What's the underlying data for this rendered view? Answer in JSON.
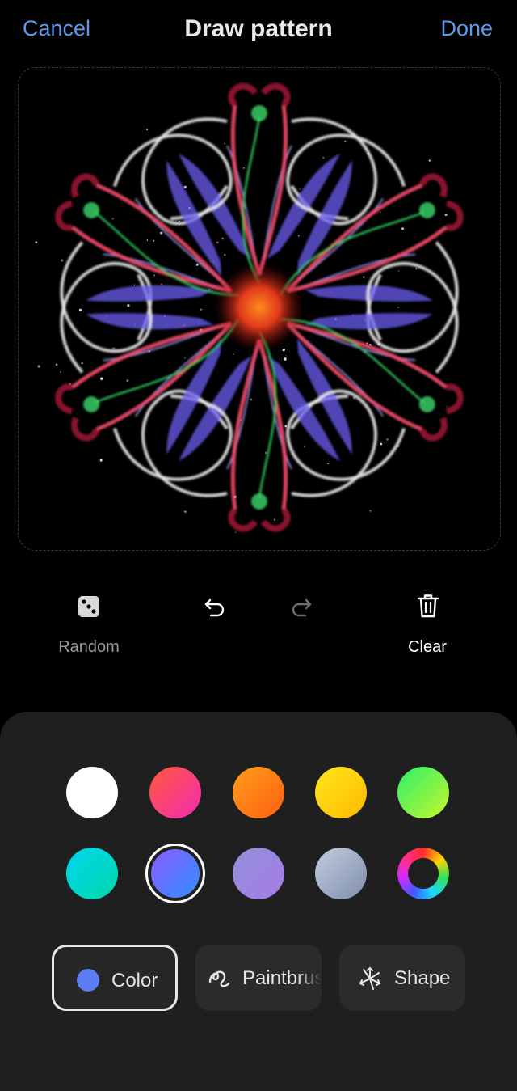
{
  "header": {
    "cancel_label": "Cancel",
    "title": "Draw pattern",
    "done_label": "Done"
  },
  "canvas": {
    "background": "#000000",
    "petal_count": 6
  },
  "tools": {
    "random_label": "Random",
    "undo_enabled": true,
    "redo_enabled": false,
    "clear_label": "Clear"
  },
  "palette": {
    "rows": [
      [
        {
          "name": "white",
          "color": "#ffffff"
        },
        {
          "name": "red-pink",
          "gradient": [
            "#ff5a3c",
            "#f22bb5"
          ]
        },
        {
          "name": "orange",
          "gradient": [
            "#ff9f1a",
            "#ff5e14"
          ]
        },
        {
          "name": "yellow",
          "gradient": [
            "#ffe81f",
            "#ffb800"
          ]
        },
        {
          "name": "green",
          "gradient": [
            "#2cf06a",
            "#c6f72c"
          ]
        }
      ],
      [
        {
          "name": "cyan",
          "gradient": [
            "#00d6f0",
            "#00d8a8"
          ]
        },
        {
          "name": "blue-violet",
          "gradient": [
            "#8c5cff",
            "#2f8fff"
          ],
          "selected": true
        },
        {
          "name": "lavender",
          "gradient": [
            "#8f92d8",
            "#a77ae8"
          ]
        },
        {
          "name": "gray-blue",
          "gradient": [
            "#c3cde0",
            "#7f8eaa"
          ]
        },
        {
          "name": "custom-color-wheel",
          "wheel": true
        }
      ]
    ]
  },
  "modes": [
    {
      "id": "color",
      "label": "Color",
      "active": true,
      "dot_color": "#5b7df2"
    },
    {
      "id": "paintbrush",
      "label": "Paintbrush",
      "active": false
    },
    {
      "id": "shape",
      "label": "Shape",
      "active": false
    }
  ]
}
